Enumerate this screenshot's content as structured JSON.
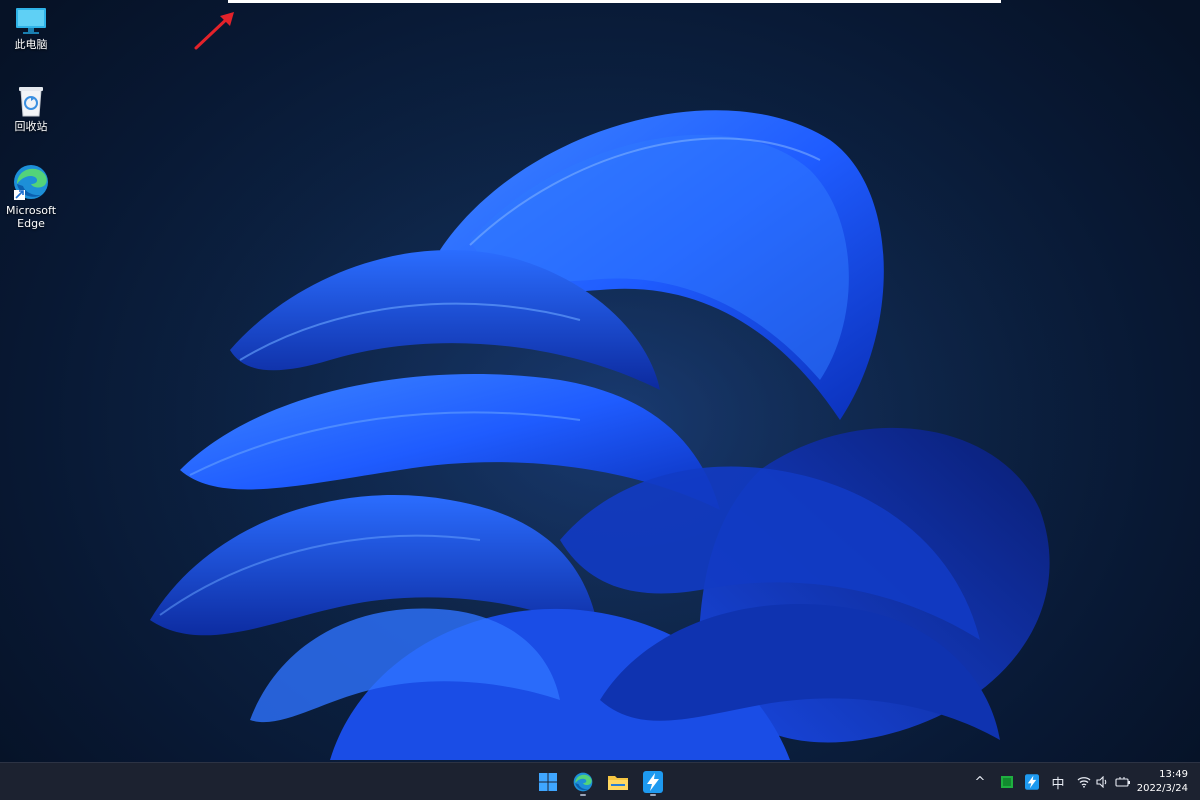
{
  "desktop": {
    "icons": [
      {
        "label": "此电脑",
        "icon": "monitor-icon"
      },
      {
        "label": "回收站",
        "icon": "recycle-bin-icon"
      },
      {
        "label": "Microsoft\nEdge",
        "icon": "edge-icon"
      }
    ]
  },
  "taskbar": {
    "apps": [
      {
        "name": "Start",
        "icon": "windows-start-icon",
        "running": false
      },
      {
        "name": "Microsoft Edge",
        "icon": "edge-icon",
        "running": true
      },
      {
        "name": "File Explorer",
        "icon": "folder-icon",
        "running": false
      },
      {
        "name": "Lightning app",
        "icon": "lightning-app-icon",
        "running": true
      }
    ],
    "tray": {
      "chevron": "^",
      "ime": "中",
      "time": "13:49",
      "date": "2022/3/24"
    }
  },
  "colors": {
    "accent_blue": "#1f5cff",
    "taskbar_bg": "#1c2230",
    "annotation_red": "#e3222a"
  }
}
